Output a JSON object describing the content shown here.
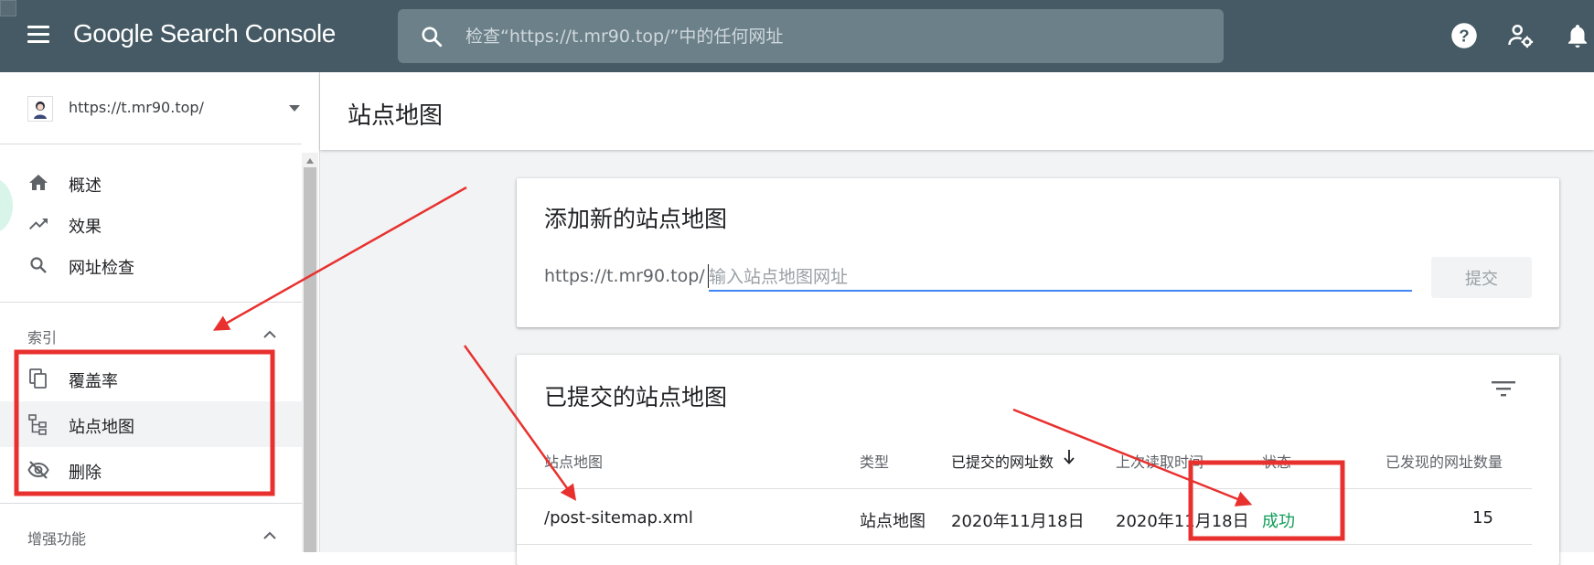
{
  "topbar": {
    "app_name": "Google Search Console",
    "search_placeholder": "检查“https://t.mr90.top/”中的任何网址",
    "icons": [
      "menu-icon",
      "search-icon",
      "help-icon",
      "admin-settings-icon",
      "notifications-icon"
    ]
  },
  "sidebar": {
    "property": "https://t.mr90.top/",
    "items": [
      {
        "label": "概述",
        "icon": "home-icon"
      },
      {
        "label": "效果",
        "icon": "trending-up-icon"
      },
      {
        "label": "网址检查",
        "icon": "search-icon"
      }
    ],
    "sections": [
      {
        "title": "索引",
        "items": [
          {
            "label": "覆盖率",
            "icon": "copy-icon"
          },
          {
            "label": "站点地图",
            "icon": "sitemap-icon",
            "active": true
          },
          {
            "label": "删除",
            "icon": "visibility-off-icon"
          }
        ]
      },
      {
        "title": "增强功能",
        "items": []
      }
    ]
  },
  "main": {
    "page_title": "站点地图",
    "add_card": {
      "title": "添加新的站点地图",
      "url_prefix": "https://t.mr90.top/",
      "input_placeholder": "输入站点地图网址",
      "submit_label": "提交"
    },
    "submitted_card": {
      "title": "已提交的站点地图",
      "columns": [
        "站点地图",
        "类型",
        "已提交的网址数",
        "上次读取时间",
        "状态",
        "已发现的网址数量"
      ],
      "rows": [
        {
          "sitemap": "/post-sitemap.xml",
          "type": "站点地图",
          "submitted": "2020年11月18日",
          "last_read": "2020年11月18日",
          "status": "成功",
          "discovered": "15"
        }
      ]
    }
  },
  "colors": {
    "topbar_bg": "#455a64",
    "accent_blue": "#4285f4",
    "success_green": "#0f9d58",
    "annotation_red": "#e8312f"
  }
}
